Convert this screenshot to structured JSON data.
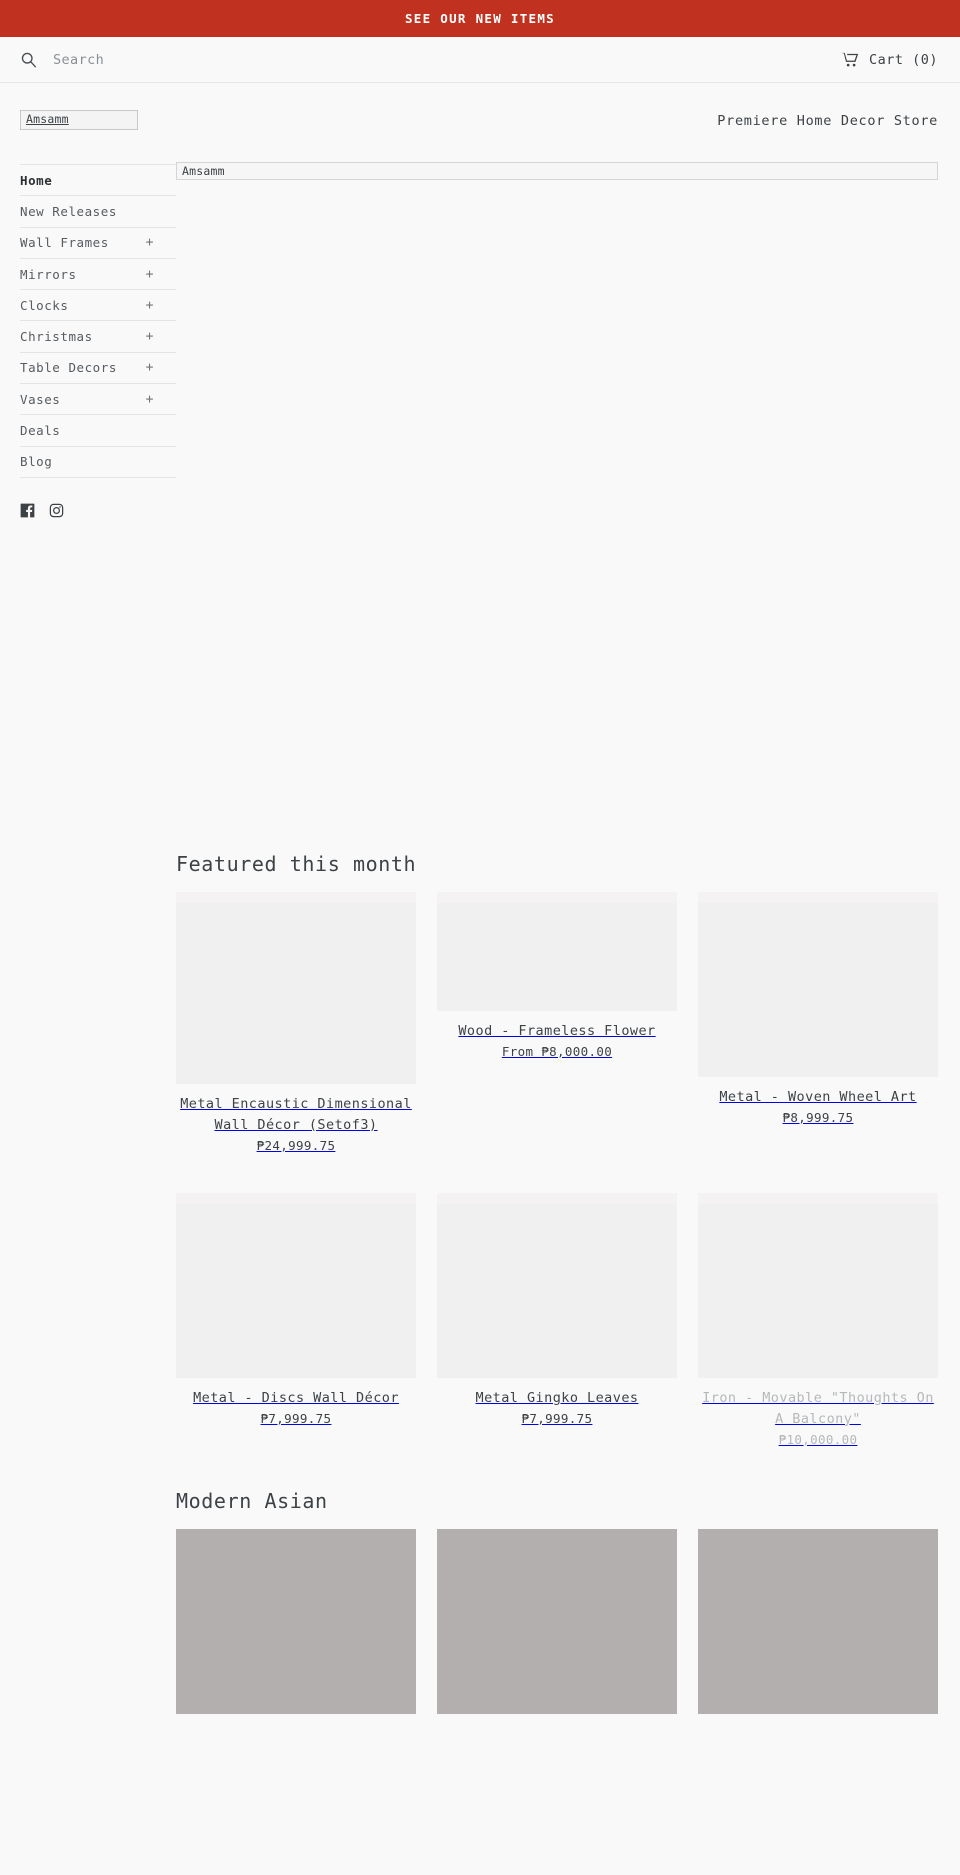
{
  "announcement": {
    "text": "SEE OUR NEW ITEMS",
    "bg": "#c0321f",
    "fg": "#ffffff"
  },
  "utilbar": {
    "search_placeholder": "Search",
    "search_value": "",
    "search_icon": "search-icon",
    "cart_label": "Cart (0)",
    "cart_icon": "cart-icon"
  },
  "masthead": {
    "logo_alt": "Amsamm",
    "tagline": "Premiere Home Decor Store"
  },
  "sidebar": {
    "items": [
      {
        "label": "Home",
        "expandable": false,
        "active": true
      },
      {
        "label": "New Releases",
        "expandable": false,
        "active": false
      },
      {
        "label": "Wall Frames",
        "expandable": true,
        "plus": "+",
        "active": false
      },
      {
        "label": "Mirrors",
        "expandable": true,
        "plus": "+",
        "active": false
      },
      {
        "label": "Clocks",
        "expandable": true,
        "plus": "+",
        "active": false
      },
      {
        "label": "Christmas",
        "expandable": true,
        "plus": "+",
        "active": false
      },
      {
        "label": "Table Decors",
        "expandable": true,
        "plus": "+",
        "active": false
      },
      {
        "label": "Vases",
        "expandable": true,
        "plus": "+",
        "active": false
      },
      {
        "label": "Deals",
        "expandable": false,
        "active": false
      },
      {
        "label": "Blog",
        "expandable": false,
        "active": false
      }
    ],
    "social": [
      {
        "name": "facebook-icon"
      },
      {
        "name": "instagram-icon"
      }
    ]
  },
  "hero": {
    "alt": "Amsamm"
  },
  "sections": [
    {
      "title": "Featured this month",
      "rows": [
        [
          {
            "title": "Metal Encaustic Dimensional Wall Décor (Setof3)",
            "price": "₱24,999.75",
            "media": "tall",
            "tone": "light",
            "muted": false
          },
          {
            "title": "Wood - Frameless Flower",
            "price": "From ₱8,000.00",
            "media": "short",
            "tone": "light",
            "muted": false
          },
          {
            "title": "Metal - Woven Wheel Art",
            "price": "₱8,999.75",
            "media": "mid",
            "tone": "light",
            "muted": false
          }
        ],
        [
          {
            "title": "Metal - Discs Wall Décor",
            "price": "₱7,999.75",
            "media": "mid",
            "tone": "light",
            "muted": false
          },
          {
            "title": "Metal Gingko Leaves",
            "price": "₱7,999.75",
            "media": "mid",
            "tone": "light",
            "muted": false
          },
          {
            "title": "Iron - Movable \"Thoughts On A Balcony\"",
            "price": "₱10,000.00",
            "media": "mid",
            "tone": "light",
            "muted": true
          }
        ]
      ]
    },
    {
      "title": "Modern Asian",
      "rows": [
        [
          {
            "title": "",
            "price": "",
            "media": "mid",
            "tone": "dark",
            "muted": false
          },
          {
            "title": "",
            "price": "",
            "media": "mid",
            "tone": "dark",
            "muted": false
          },
          {
            "title": "",
            "price": "",
            "media": "mid",
            "tone": "dark",
            "muted": false
          }
        ]
      ]
    }
  ]
}
